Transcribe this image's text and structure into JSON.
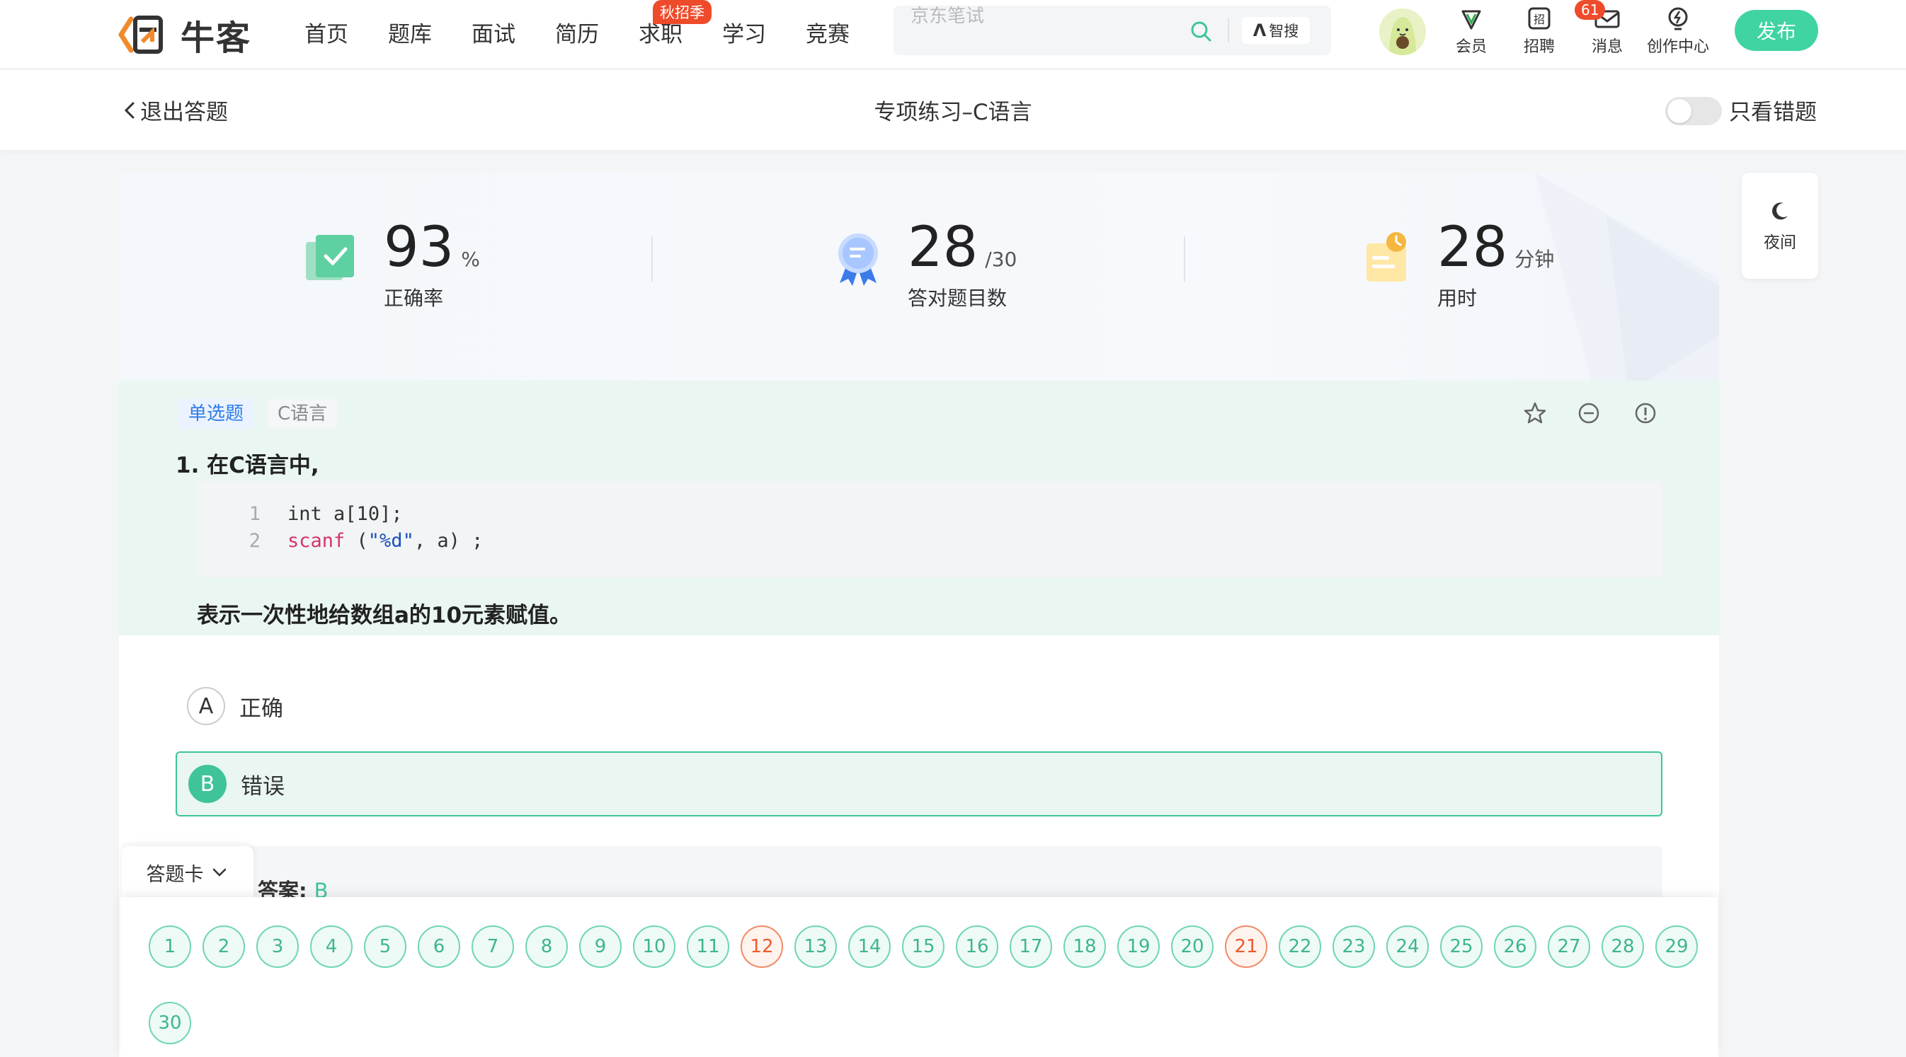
{
  "nav": {
    "logo_text": "牛客",
    "links": [
      "首页",
      "题库",
      "面试",
      "简历",
      "求职",
      "学习",
      "竞赛"
    ],
    "hot_badge": "秋招季",
    "search_placeholder": "京东笔试",
    "zhisou_label": "智搜",
    "items": [
      "会员",
      "招聘",
      "消息",
      "创作中心"
    ],
    "message_count": "61",
    "publish_label": "发布"
  },
  "subheader": {
    "back_label": "退出答题",
    "title": "专项练习–C语言",
    "toggle_label": "只看错题",
    "toggle_on": false
  },
  "stats": {
    "accuracy": {
      "value": "93",
      "unit": "%",
      "label": "正确率"
    },
    "correct": {
      "value": "28",
      "unit": "/30",
      "label": "答对题目数"
    },
    "time": {
      "value": "28",
      "unit": "分钟",
      "label": "用时"
    }
  },
  "question": {
    "type_tag": "单选题",
    "lang_tag": "C语言",
    "title": "1. 在C语言中,",
    "code": [
      {
        "ln": "1",
        "text": "int a[10];"
      },
      {
        "ln": "2",
        "text": "scanf (\"%d\", a) ;"
      }
    ],
    "description": "表示一次性地给数组a的10元素赋值。",
    "options": [
      {
        "letter": "A",
        "text": "正确",
        "selected": false
      },
      {
        "letter": "B",
        "text": "错误",
        "selected": true
      }
    ],
    "answer_label": "答案:",
    "answer_value": "B"
  },
  "answer_sheet": {
    "tab_label": "答题卡",
    "numbers": [
      "1",
      "2",
      "3",
      "4",
      "5",
      "6",
      "7",
      "8",
      "9",
      "10",
      "11",
      "12",
      "13",
      "14",
      "15",
      "16",
      "17",
      "18",
      "19",
      "20",
      "21",
      "22",
      "23",
      "24",
      "25",
      "26",
      "27",
      "28",
      "29",
      "30"
    ],
    "wrong": [
      "12",
      "21"
    ]
  },
  "night_mode": {
    "label": "夜间"
  },
  "colors": {
    "brand": "#3fd4a1",
    "correct": "#3fc49a",
    "wrong": "#ee5a2c",
    "badge": "#ee4b2b"
  }
}
